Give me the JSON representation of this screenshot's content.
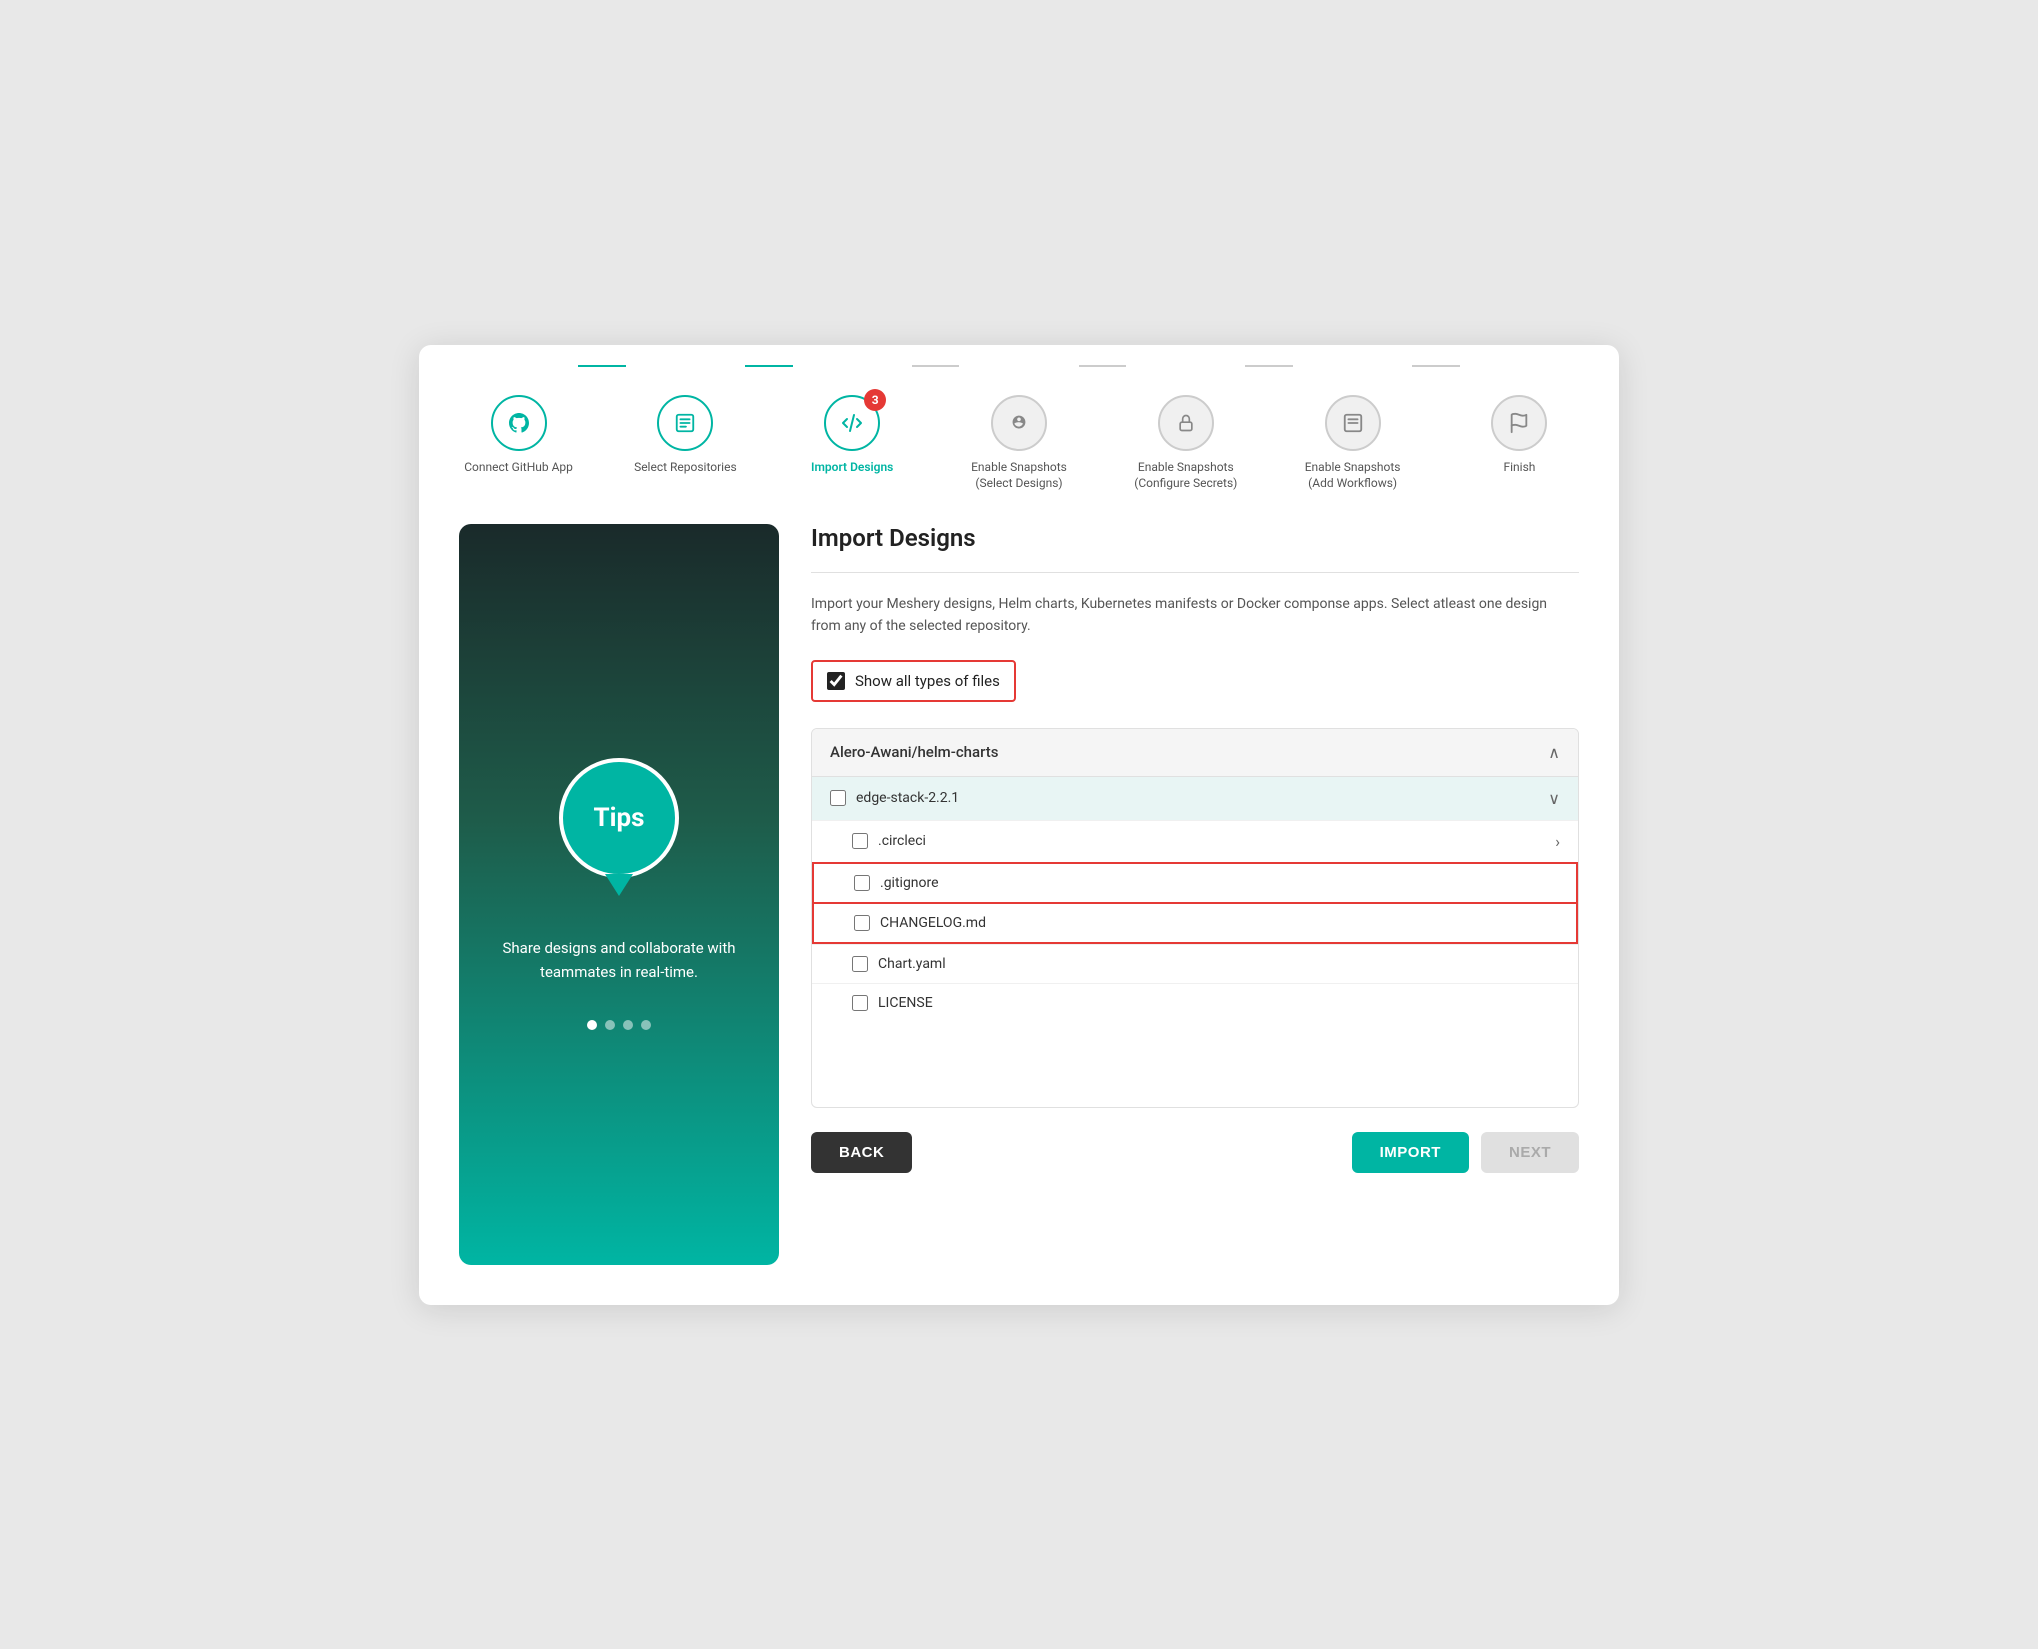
{
  "stepper": {
    "steps": [
      {
        "label": "Connect GitHub App",
        "state": "completed",
        "icon": "🐙",
        "badge": null
      },
      {
        "label": "Select Repositories",
        "state": "completed",
        "icon": "📋",
        "badge": null
      },
      {
        "label": "Import Designs",
        "state": "active",
        "icon": "⇄",
        "badge": "3"
      },
      {
        "label": "Enable Snapshots (Select Designs)",
        "state": "inactive",
        "icon": "⚙",
        "badge": null
      },
      {
        "label": "Enable Snapshots (Configure Secrets)",
        "state": "inactive",
        "icon": "🔒",
        "badge": null
      },
      {
        "label": "Enable Snapshots (Add Workflows)",
        "state": "inactive",
        "icon": "📄",
        "badge": null
      },
      {
        "label": "Finish",
        "state": "inactive",
        "icon": "⚑",
        "badge": null
      }
    ]
  },
  "left_panel": {
    "tips_label": "Tips",
    "description": "Share designs and collaborate with teammates in real-time.",
    "dots": [
      1,
      2,
      3,
      4
    ],
    "active_dot": 1
  },
  "right_panel": {
    "title": "Import Designs",
    "description": "Import your Meshery designs, Helm charts, Kubernetes manifests or Docker componse apps. Select atleast one design from any of the selected repository.",
    "show_all_files_label": "Show all types of files",
    "show_all_files_checked": true,
    "repo_name": "Alero-Awani/helm-charts",
    "folder": {
      "name": "edge-stack-2.2.1",
      "expanded": true
    },
    "files": [
      {
        "name": ".circleci",
        "type": "folder",
        "has_arrow": true
      },
      {
        "name": ".gitignore",
        "type": "file",
        "highlighted": true
      },
      {
        "name": "CHANGELOG.md",
        "type": "file",
        "highlighted": true
      },
      {
        "name": "Chart.yaml",
        "type": "file",
        "highlighted": false
      },
      {
        "name": "LICENSE",
        "type": "file",
        "highlighted": false
      }
    ]
  },
  "buttons": {
    "back_label": "BACK",
    "import_label": "IMPORT",
    "next_label": "NEXT"
  }
}
